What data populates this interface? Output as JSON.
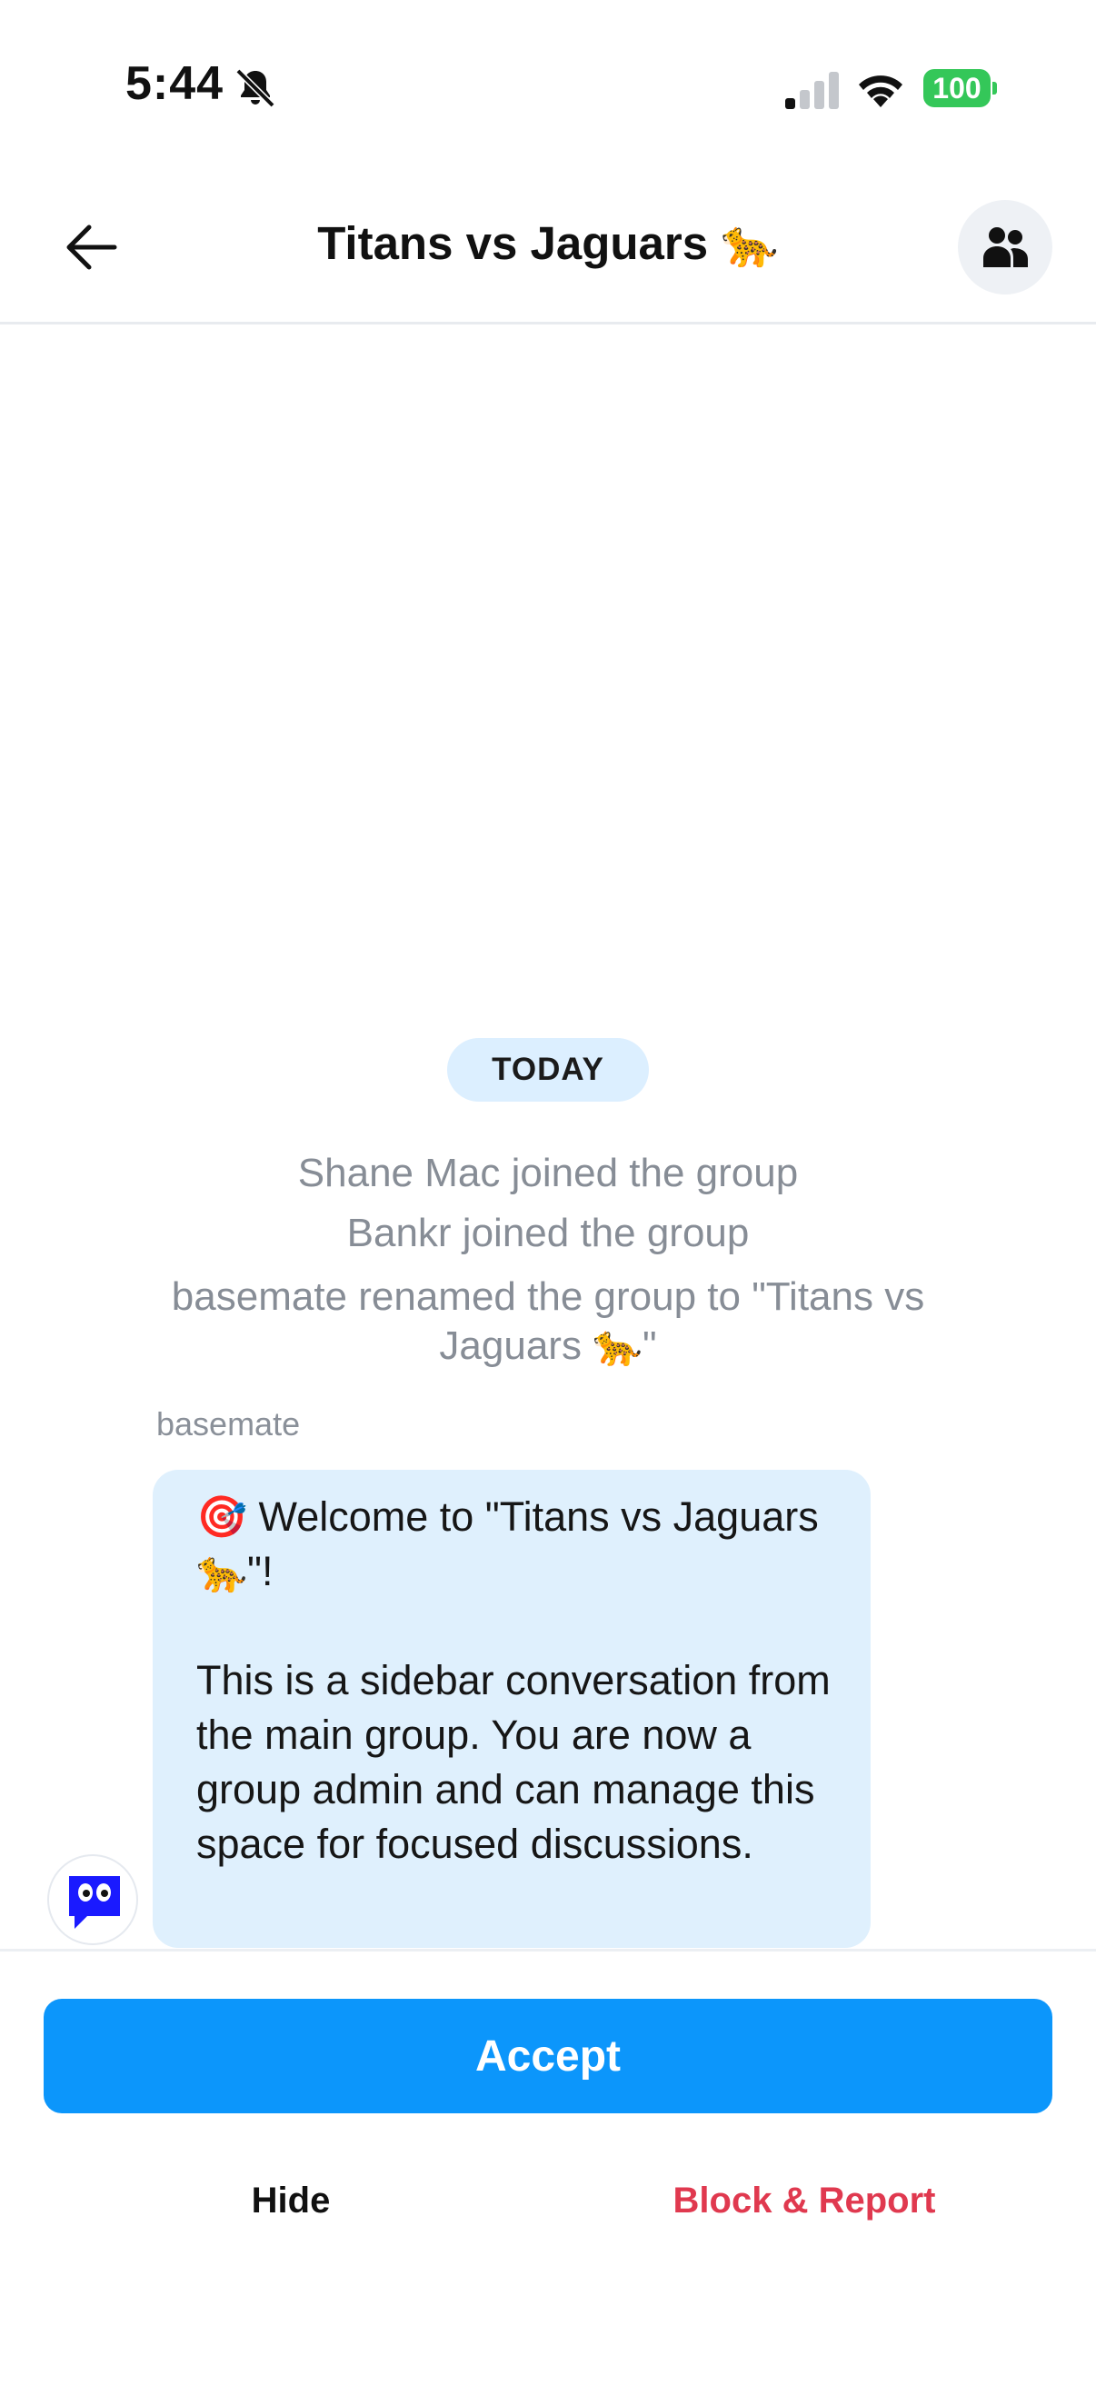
{
  "status_bar": {
    "time": "5:44",
    "battery": "100",
    "icons": [
      "bell-slash-icon",
      "signal-icon",
      "wifi-icon",
      "battery-icon"
    ],
    "battery_color": "#34c759"
  },
  "header": {
    "title": "Titans vs Jaguars 🐆",
    "back_icon": "arrow-left-icon",
    "members_icon": "people-icon"
  },
  "chat": {
    "date_divider": "TODAY",
    "system_messages": [
      "Shane Mac joined the group",
      "Bankr joined the group",
      "basemate renamed the group to \"Titans vs Jaguars 🐆\""
    ],
    "messages": [
      {
        "sender": "basemate",
        "text": "🎯 Welcome to \"Titans vs Jaguars 🐆\"!\n\nThis is a sidebar conversation from the main group. You are now a group admin and can manage this space for focused discussions."
      }
    ]
  },
  "actions": {
    "accept_label": "Accept",
    "hide_label": "Hide",
    "block_report_label": "Block & Report"
  },
  "colors": {
    "accent": "#0c96fb",
    "danger": "#e0394f",
    "bubble": "#dff0fd",
    "pill": "#dcefff"
  }
}
